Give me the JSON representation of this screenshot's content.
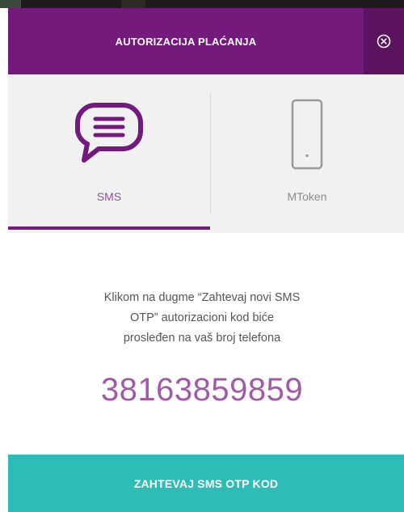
{
  "header": {
    "title": "AUTORIZACIJA PLAĆANJA",
    "close_icon": "close-circle-icon"
  },
  "tabs": [
    {
      "label": "SMS",
      "icon": "chat-bubble-icon",
      "selected": true
    },
    {
      "label": "MToken",
      "icon": "tablet-device-icon",
      "selected": false
    }
  ],
  "info": {
    "line1": "Klikom na dugme “Zahtevaj novi SMS",
    "line2": "OTP” autorizacioni kod biće",
    "line3": "prosleđen na vaš broj telefona"
  },
  "phone_number": "38163859859",
  "submit_label": "ZAHTEVAJ SMS OTP KOD",
  "colors": {
    "header": "#731a7c",
    "accent_purple": "#a05aa6",
    "submit": "#2ebcb6",
    "tab_bg": "#f1f1f2"
  }
}
